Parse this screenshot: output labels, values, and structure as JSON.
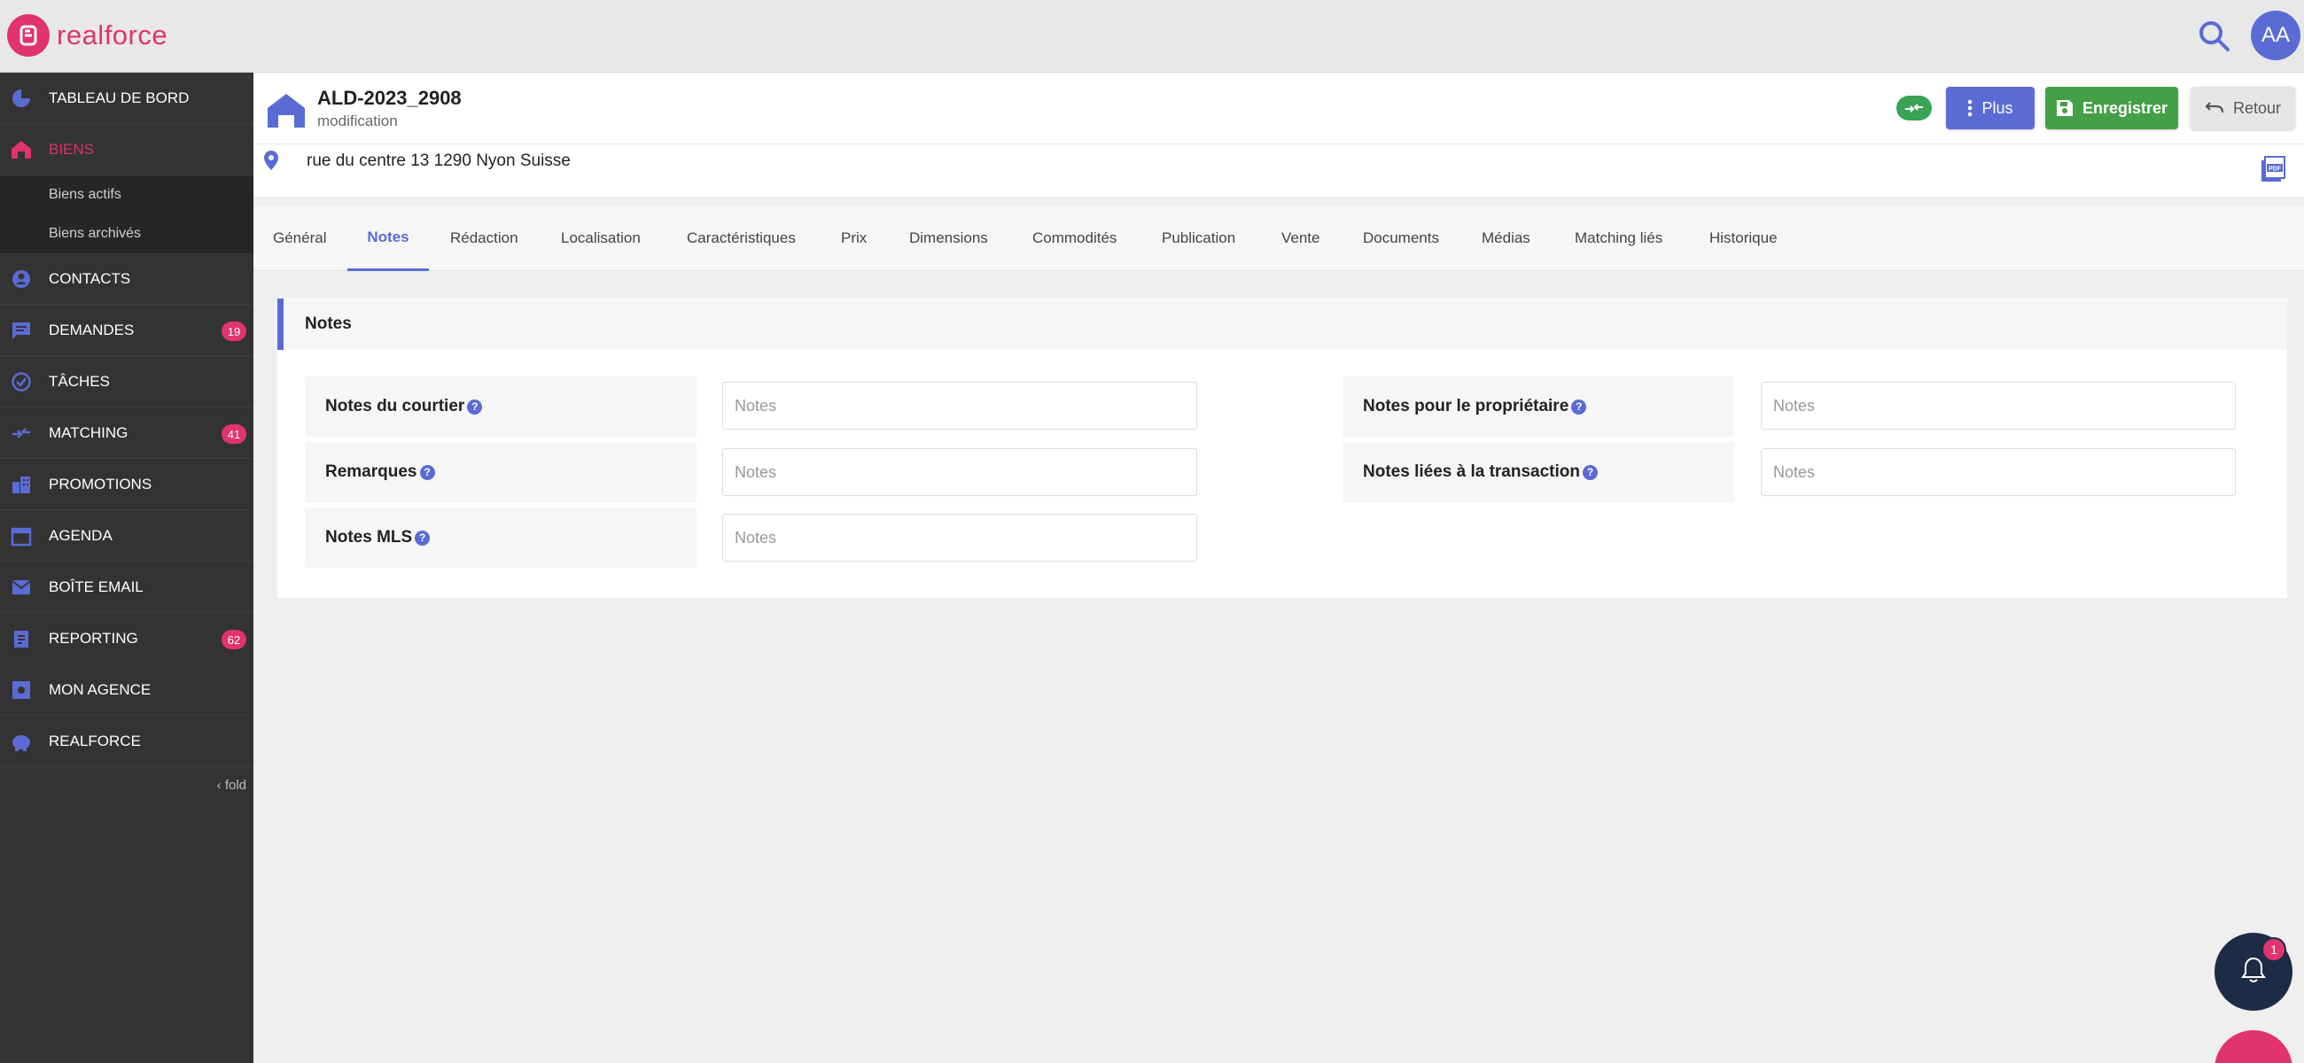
{
  "app": {
    "logo_text": "realforce",
    "avatar_initials": "AA",
    "brand_color": "#e0336f",
    "accent_color": "#5b6bd5"
  },
  "sidebar": {
    "items": [
      {
        "label": "TABLEAU DE BORD",
        "icon": "pie-chart-icon"
      },
      {
        "label": "BIENS",
        "icon": "house-icon",
        "active": true
      },
      {
        "label": "CONTACTS",
        "icon": "user-circle-icon"
      },
      {
        "label": "DEMANDES",
        "icon": "chat-icon",
        "badge": "19"
      },
      {
        "label": "TÂCHES",
        "icon": "check-circle-icon"
      },
      {
        "label": "MATCHING",
        "icon": "swap-icon",
        "badge": "41"
      },
      {
        "label": "PROMOTIONS",
        "icon": "buildings-icon"
      },
      {
        "label": "AGENDA",
        "icon": "calendar-icon"
      },
      {
        "label": "BOÎTE EMAIL",
        "icon": "mail-icon"
      },
      {
        "label": "REPORTING",
        "icon": "clipboard-icon",
        "badge": "62"
      },
      {
        "label": "MON AGENCE",
        "icon": "agency-icon"
      },
      {
        "label": "REALFORCE",
        "icon": "piggy-bank-icon"
      }
    ],
    "subitems": [
      "Biens actifs",
      "Biens archivés"
    ],
    "fold_label": "fold"
  },
  "header": {
    "title": "ALD-2023_2908",
    "subtitle": "modification",
    "address": "rue du centre 13 1290 Nyon Suisse",
    "plus_label": "Plus",
    "save_label": "Enregistrer",
    "back_label": "Retour",
    "status_color": "#3aa356"
  },
  "tabs": [
    "Général",
    "Notes",
    "Rédaction",
    "Localisation",
    "Caractéristiques",
    "Prix",
    "Dimensions",
    "Commodités",
    "Publication",
    "Vente",
    "Documents",
    "Médias",
    "Matching liés",
    "Historique"
  ],
  "active_tab": "Notes",
  "notes_panel": {
    "title": "Notes",
    "help_glyph": "?",
    "fields": [
      {
        "label": "Notes du courtier",
        "placeholder": "Notes"
      },
      {
        "label": "Remarques",
        "placeholder": "Notes"
      },
      {
        "label": "Notes MLS",
        "placeholder": "Notes"
      },
      {
        "label": "Notes pour le propriétaire",
        "placeholder": "Notes"
      },
      {
        "label": "Notes liées à la transaction",
        "placeholder": "Notes"
      }
    ]
  },
  "notifications": {
    "count": "1"
  }
}
